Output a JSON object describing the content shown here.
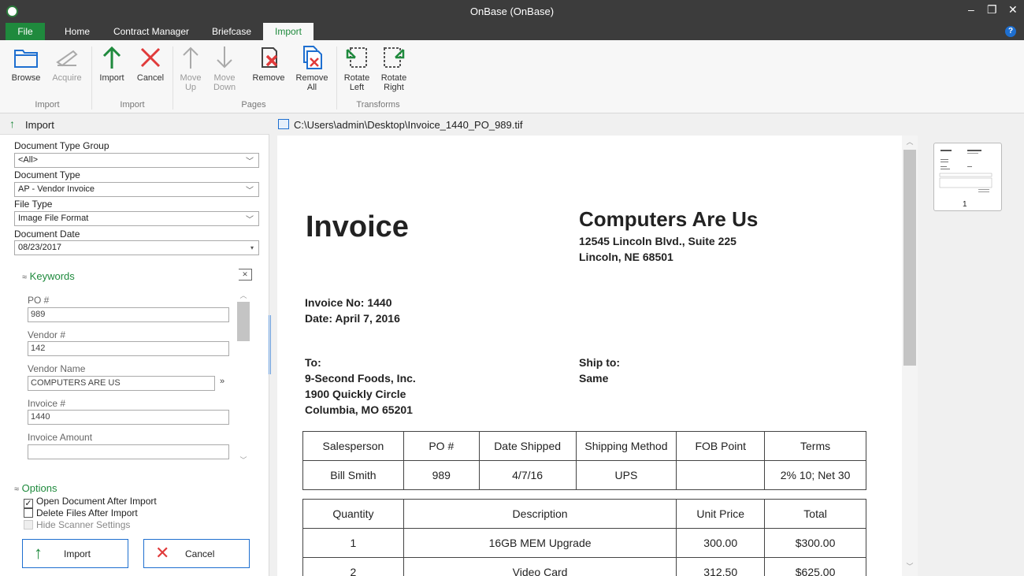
{
  "window": {
    "title": "OnBase (OnBase)"
  },
  "tabs": [
    {
      "label": "File"
    },
    {
      "label": "Home"
    },
    {
      "label": "Contract Manager"
    },
    {
      "label": "Briefcase"
    },
    {
      "label": "Import"
    }
  ],
  "ribbon": {
    "browse": "Browse",
    "acquire": "Acquire",
    "import": "Import",
    "cancel": "Cancel",
    "move_up_1": "Move",
    "move_up_2": "Up",
    "move_down_1": "Move",
    "move_down_2": "Down",
    "remove": "Remove",
    "remove_all_1": "Remove",
    "remove_all_2": "All",
    "rotate_left_1": "Rotate",
    "rotate_left_2": "Left",
    "rotate_right_1": "Rotate",
    "rotate_right_2": "Right",
    "groups": {
      "import_1": "Import",
      "import_2": "Import",
      "pages": "Pages",
      "transforms": "Transforms"
    }
  },
  "left_panel": {
    "header": "Import",
    "doc_type_group_label": "Document Type Group",
    "doc_type_group_value": "<All>",
    "doc_type_label": "Document Type",
    "doc_type_value": "AP - Vendor Invoice",
    "file_type_label": "File Type",
    "file_type_value": "Image File Format",
    "doc_date_label": "Document Date",
    "doc_date_value": "08/23/2017",
    "keywords_title": "Keywords",
    "keywords": {
      "po_label": "PO #",
      "po_value": "989",
      "vendor_num_label": "Vendor #",
      "vendor_num_value": "142",
      "vendor_name_label": "Vendor Name",
      "vendor_name_value": "COMPUTERS ARE US",
      "invoice_num_label": "Invoice #",
      "invoice_num_value": "1440",
      "invoice_amount_label": "Invoice Amount",
      "invoice_amount_value": ""
    },
    "options_title": "Options",
    "options": {
      "open_after": "Open Document After Import",
      "delete_after": "Delete Files After Import",
      "hide_scanner": "Hide Scanner Settings"
    },
    "import_button": "Import",
    "cancel_button": "Cancel"
  },
  "viewer": {
    "path": "C:\\Users\\admin\\Desktop\\Invoice_1440_PO_989.tif",
    "thumbnail_page": "1"
  },
  "invoice": {
    "title": "Invoice",
    "company_name": "Computers Are Us",
    "company_addr1": "12545 Lincoln Blvd., Suite 225",
    "company_addr2": "Lincoln, NE 68501",
    "invoice_no": "Invoice No: 1440",
    "date": "Date: April 7, 2016",
    "to_label": "To:",
    "to_line1": "9-Second Foods, Inc.",
    "to_line2": "1900 Quickly Circle",
    "to_line3": "Columbia, MO 65201",
    "ship_to_label": "Ship to:",
    "ship_to_value": "Same",
    "table1_headers": [
      "Salesperson",
      "PO #",
      "Date Shipped",
      "Shipping Method",
      "FOB Point",
      "Terms"
    ],
    "table1_row": [
      "Bill Smith",
      "989",
      "4/7/16",
      "UPS",
      "",
      "2% 10; Net 30"
    ],
    "table2_headers": [
      "Quantity",
      "Description",
      "Unit Price",
      "Total"
    ],
    "table2_rows": [
      [
        "1",
        "16GB MEM Upgrade",
        "300.00",
        "$300.00"
      ],
      [
        "2",
        "Video Card",
        "312.50",
        "$625.00"
      ]
    ]
  },
  "colors": {
    "accent_green": "#1f8a3d",
    "accent_blue": "#1e6fd0",
    "titlebar": "#3c3c3c"
  }
}
